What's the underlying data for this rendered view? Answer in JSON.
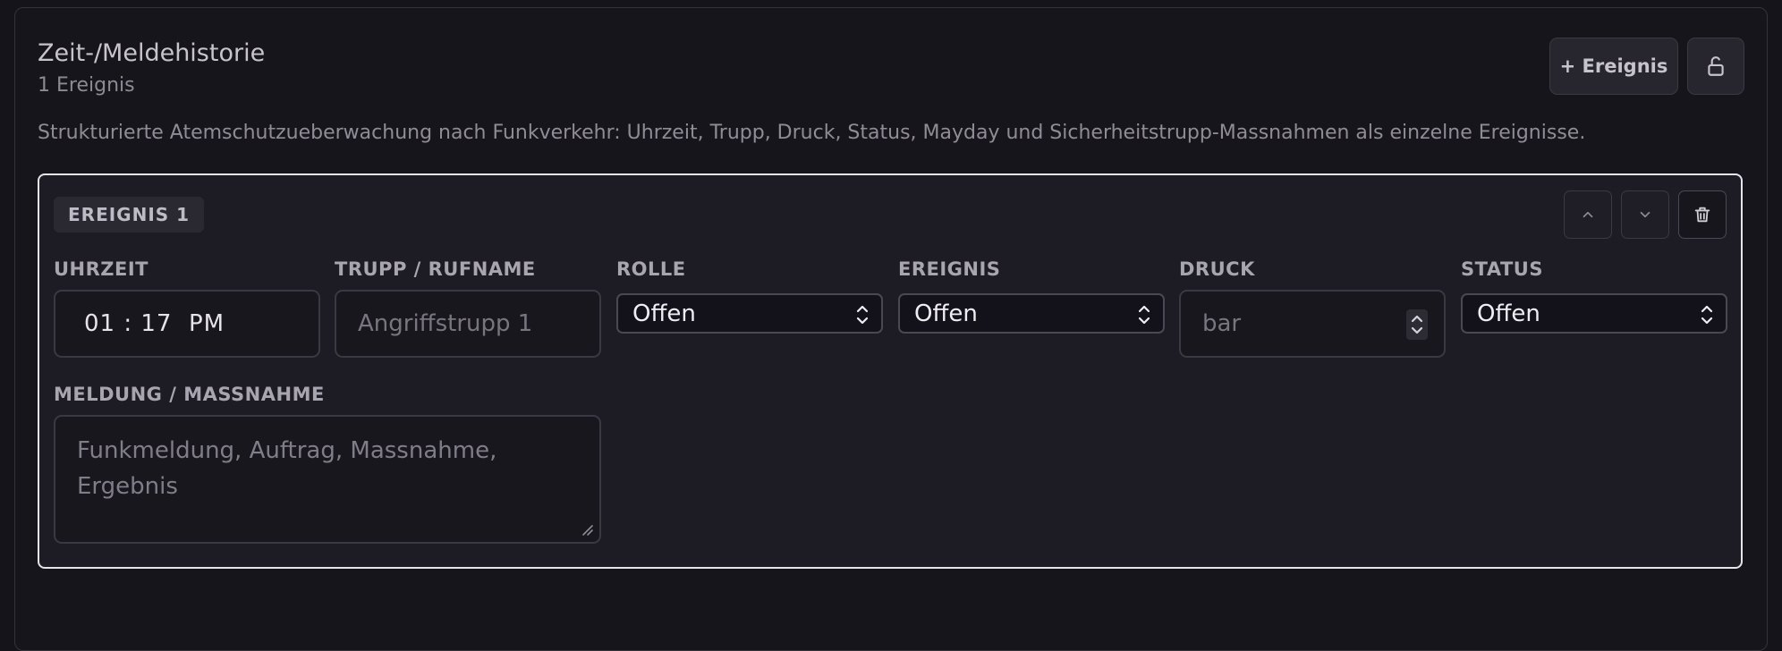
{
  "section": {
    "title": "Zeit-/Meldehistorie",
    "count": "1 Ereignis",
    "description": "Strukturierte Atemschutzueberwachung nach Funkverkehr: Uhrzeit, Trupp, Druck, Status, Mayday und Sicherheitstrupp-Massnahmen als einzelne Ereignisse.",
    "add_button": "+ Ereignis",
    "lock_icon": "unlock-icon"
  },
  "event": {
    "badge": "EREIGNIS 1",
    "icons": {
      "up": "chevron-up-icon",
      "down": "chevron-down-icon",
      "delete": "trash-icon"
    },
    "fields": {
      "uhrzeit_label": "UHRZEIT",
      "uhrzeit_value": "01 : 17  PM",
      "trupp_label": "TRUPP / RUFNAME",
      "trupp_placeholder": "Angriffstrupp 1",
      "rolle_label": "ROLLE",
      "rolle_value": "Offen",
      "ereignis_label": "EREIGNIS",
      "ereignis_value": "Offen",
      "druck_label": "DRUCK",
      "druck_placeholder": "bar",
      "status_label": "STATUS",
      "status_value": "Offen",
      "meldung_label": "MELDUNG / MASSNAHME",
      "meldung_placeholder": "Funkmeldung, Auftrag, Massnahme, Ergebnis"
    }
  },
  "colors": {
    "background": "#16141b",
    "card_border": "#e6e4ea",
    "field_border": "#3a3842",
    "text": "#c9c6cf"
  }
}
